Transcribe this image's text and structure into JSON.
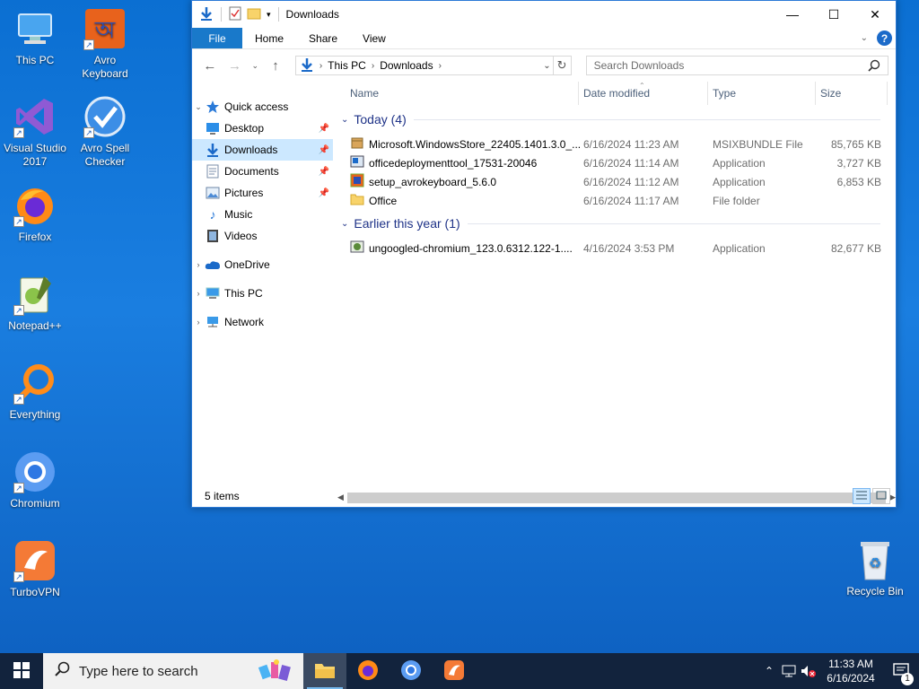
{
  "desktop": {
    "icons": [
      {
        "label": "This PC"
      },
      {
        "label": "Avro Keyboard"
      },
      {
        "label": "Visual Studio 2017"
      },
      {
        "label": "Avro Spell Checker"
      },
      {
        "label": "Firefox"
      },
      {
        "label": "Notepad++"
      },
      {
        "label": "Everything"
      },
      {
        "label": "Chromium"
      },
      {
        "label": "TurboVPN"
      },
      {
        "label": "Recycle Bin"
      }
    ]
  },
  "window": {
    "title": "Downloads",
    "controls": {
      "minimize": "—",
      "maximize": "☐",
      "close": "✕"
    }
  },
  "ribbon": {
    "tabs": [
      "File",
      "Home",
      "Share",
      "View"
    ]
  },
  "address": {
    "crumbs": [
      "This PC",
      "Downloads"
    ]
  },
  "search": {
    "placeholder": "Search Downloads"
  },
  "nav": {
    "quick_access": "Quick access",
    "items": [
      "Desktop",
      "Downloads",
      "Documents",
      "Pictures",
      "Music",
      "Videos"
    ],
    "onedrive": "OneDrive",
    "thispc": "This PC",
    "network": "Network"
  },
  "columns": {
    "name": "Name",
    "date": "Date modified",
    "type": "Type",
    "size": "Size"
  },
  "groups": [
    {
      "label": "Today (4)",
      "files": [
        {
          "name": "Microsoft.WindowsStore_22405.1401.3.0_...",
          "date": "6/16/2024 11:23 AM",
          "type": "MSIXBUNDLE File",
          "size": "85,765 KB",
          "icon": "package-icon"
        },
        {
          "name": "officedeploymenttool_17531-20046",
          "date": "6/16/2024 11:14 AM",
          "type": "Application",
          "size": "3,727 KB",
          "icon": "installer-icon"
        },
        {
          "name": "setup_avrokeyboard_5.6.0",
          "date": "6/16/2024 11:12 AM",
          "type": "Application",
          "size": "6,853 KB",
          "icon": "avro-setup-icon"
        },
        {
          "name": "Office",
          "date": "6/16/2024 11:17 AM",
          "type": "File folder",
          "size": "",
          "icon": "folder-icon"
        }
      ]
    },
    {
      "label": "Earlier this year (1)",
      "files": [
        {
          "name": "ungoogled-chromium_123.0.6312.122-1....",
          "date": "4/16/2024 3:53 PM",
          "type": "Application",
          "size": "82,677 KB",
          "icon": "installer-icon"
        }
      ]
    }
  ],
  "status": {
    "items": "5 items"
  },
  "taskbar": {
    "search_placeholder": "Type here to search",
    "time": "11:33 AM",
    "date": "6/16/2024",
    "notifications": "1"
  },
  "colors": {
    "accent": "#1979ca",
    "selection": "#cce8ff",
    "taskbar": "#12233d"
  }
}
